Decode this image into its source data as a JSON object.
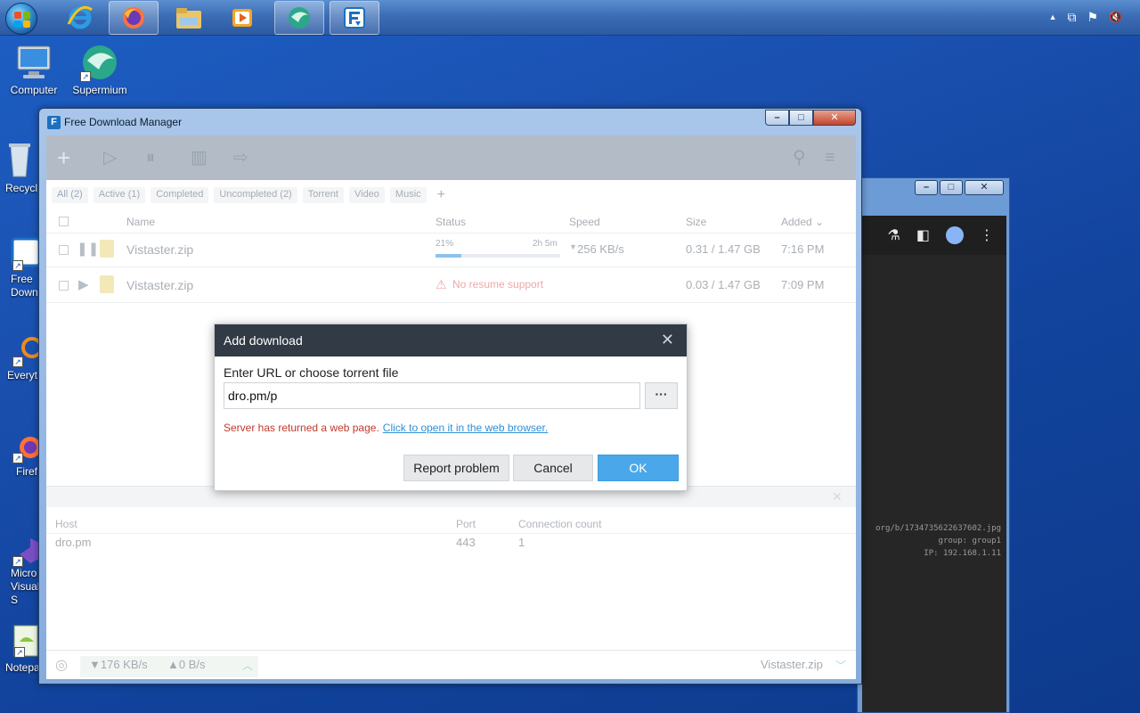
{
  "taskbar": {
    "apps": [
      {
        "name": "internet-explorer-icon"
      },
      {
        "name": "firefox-icon"
      },
      {
        "name": "file-explorer-icon"
      },
      {
        "name": "media-player-icon"
      },
      {
        "name": "supermium-icon"
      },
      {
        "name": "free-download-manager-icon"
      }
    ],
    "tray": {
      "arrow": "▲",
      "network": "⧉",
      "flag": "⚑",
      "volume": "🔇"
    }
  },
  "desktop": {
    "icons": [
      {
        "label": "Computer"
      },
      {
        "label": "Supermium"
      },
      {
        "label": "Recycl"
      },
      {
        "label": "Free Down"
      },
      {
        "label": "Everyt"
      },
      {
        "label": "Firef"
      },
      {
        "label": "Micro Visual S"
      },
      {
        "label": "Notepa"
      }
    ]
  },
  "background_window": {
    "toolbar_icons": [
      "flask-icon",
      "sidebar-icon",
      "profile-icon",
      "menu-icon"
    ],
    "lines": [
      "org/b/1734735622637602.jpg",
      "group: group1",
      "IP: 192.168.1.11"
    ]
  },
  "fdm": {
    "title": "Free Download Manager",
    "filters": [
      {
        "label": "All (2)"
      },
      {
        "label": "Active (1)"
      },
      {
        "label": "Completed"
      },
      {
        "label": "Uncompleted (2)"
      },
      {
        "label": "Torrent"
      },
      {
        "label": "Video"
      },
      {
        "label": "Music"
      }
    ],
    "columns": {
      "name": "Name",
      "status": "Status",
      "speed": "Speed",
      "size": "Size",
      "added": "Added ⌄"
    },
    "downloads": [
      {
        "name": "Vistaster.zip",
        "progress_label": "21%",
        "progress": 0.21,
        "eta": "2h 5m",
        "speed": "256 KB/s",
        "size": "0.31 / 1.47 GB",
        "added": "7:16 PM"
      },
      {
        "name": "Vistaster.zip",
        "status": "No resume support",
        "speed": "",
        "size": "0.03 / 1.47 GB",
        "added": "7:09 PM"
      }
    ],
    "details": {
      "host_header": "Host",
      "port_header": "Port",
      "connections_header": "Connection count",
      "host": "dro.pm",
      "port": "443",
      "connections": "1"
    },
    "status_bar": {
      "down_speed": "▼176 KB/s",
      "up_speed": "▲0 B/s",
      "current": "Vistaster.zip"
    }
  },
  "dialog": {
    "title": "Add download",
    "label": "Enter URL or choose torrent file",
    "url_value": "dro.pm/p",
    "browse_label": "···",
    "error_text": "Server has returned a web page.",
    "error_link": "Click to open it in the web browser.",
    "report_label": "Report problem",
    "cancel_label": "Cancel",
    "ok_label": "OK",
    "colors": {
      "ok": "#4aa8ea",
      "error": "#c0392b",
      "link": "#2f8fd6",
      "header": "#323a45"
    }
  }
}
